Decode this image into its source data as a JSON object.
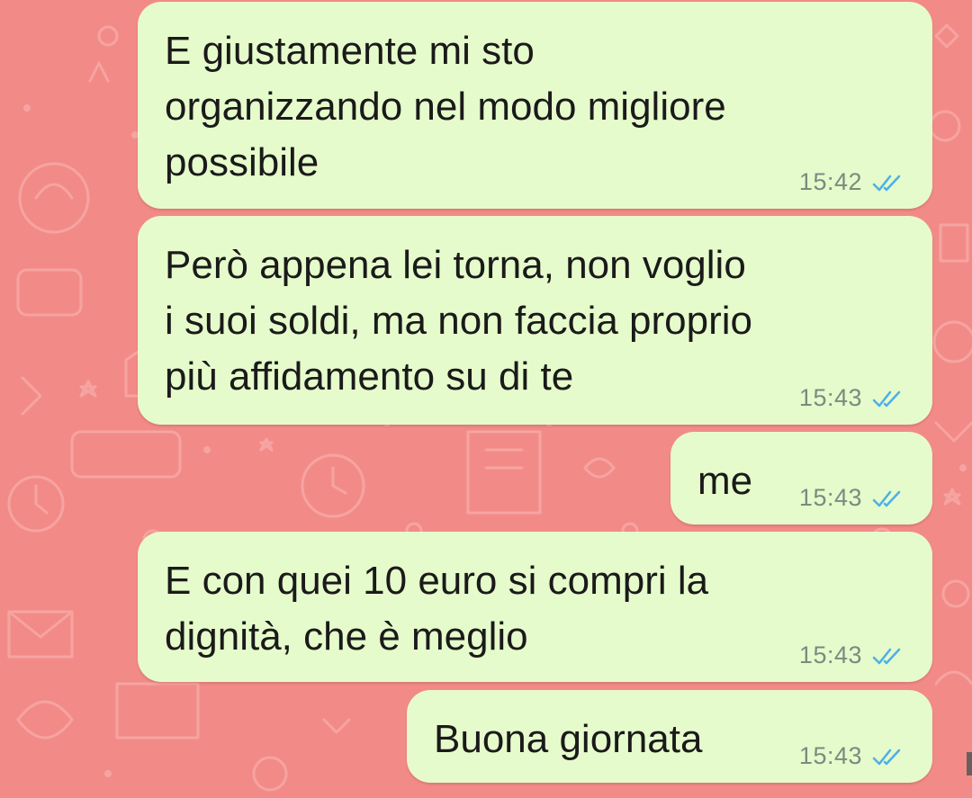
{
  "chat": {
    "messages": [
      {
        "text": "E giustamente mi sto\norganizzando nel modo migliore\npossibile",
        "time": "15:42",
        "status": "read"
      },
      {
        "text": "Però appena lei torna, non voglio\ni suoi soldi, ma non faccia proprio\npiù affidamento su di te",
        "time": "15:43",
        "status": "read"
      },
      {
        "text": "me",
        "time": "15:43",
        "status": "read"
      },
      {
        "text": "E con quei 10 euro si compri la\ndignità, che è meglio",
        "time": "15:43",
        "status": "read"
      },
      {
        "text": "Buona giornata",
        "time": "15:43",
        "status": "read"
      }
    ]
  },
  "colors": {
    "wallpaper": "#f28b88",
    "bubble_outgoing": "#e6fbcb",
    "read_ticks": "#4fb0e8",
    "timestamp": "#7c8a80"
  },
  "icons": {
    "status": "double-check-icon"
  }
}
